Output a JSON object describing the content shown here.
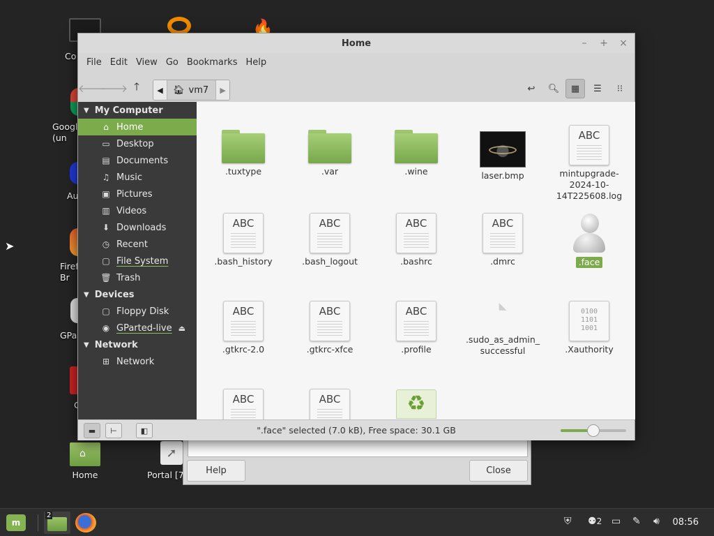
{
  "desktop": {
    "icons": [
      {
        "label": "Co"
      },
      {
        "label": "Googl\n(un"
      },
      {
        "label": "Au"
      },
      {
        "label": "Firef\nBr"
      },
      {
        "label": "GPa"
      },
      {
        "label": "G"
      },
      {
        "label": "Home"
      },
      {
        "label": "Portal [7"
      }
    ]
  },
  "background_dialog": {
    "help_label": "Help",
    "close_label": "Close"
  },
  "window": {
    "title": "Home",
    "controls": {
      "minimize": "–",
      "maximize": "+",
      "close": "×"
    }
  },
  "menu": [
    "File",
    "Edit",
    "View",
    "Go",
    "Bookmarks",
    "Help"
  ],
  "pathbar": {
    "current": "vm7"
  },
  "sidebar": {
    "my_computer": {
      "header": "My Computer",
      "items": [
        "Home",
        "Desktop",
        "Documents",
        "Music",
        "Pictures",
        "Videos",
        "Downloads",
        "Recent",
        "File System",
        "Trash"
      ]
    },
    "devices": {
      "header": "Devices",
      "items": [
        "Floppy Disk",
        "GParted-live"
      ]
    },
    "network": {
      "header": "Network",
      "items": [
        "Network"
      ]
    }
  },
  "files": [
    {
      "name": ".tuxtype"
    },
    {
      "name": ".var"
    },
    {
      "name": ".wine"
    },
    {
      "name": "laser.bmp"
    },
    {
      "name": "mintupgrade-\n2024-10-\n14T225608.log"
    },
    {
      "name": ".bash_history"
    },
    {
      "name": ".bash_logout"
    },
    {
      "name": ".bashrc"
    },
    {
      "name": ".dmrc"
    },
    {
      "name": ".face"
    },
    {
      "name": ".gtkrc-2.0"
    },
    {
      "name": ".gtkrc-xfce"
    },
    {
      "name": ".profile"
    },
    {
      "name": ".sudo_as_admin_\nsuccessful"
    },
    {
      "name": ".Xauthority"
    }
  ],
  "doc_icon_text": "ABC",
  "binary_icon_text": "0100\n1101\n1001",
  "status": {
    "text": "\".face\" selected (7.0 kB), Free space: 30.1 GB",
    "zoom_level": 0.5
  },
  "taskbar": {
    "window_count_badge": "2",
    "user_count": "2",
    "clock": "08:56"
  },
  "colors": {
    "accent": "#7cab4c",
    "sidebar_bg": "#3a3a3a",
    "desktop_bg": "#242424"
  }
}
